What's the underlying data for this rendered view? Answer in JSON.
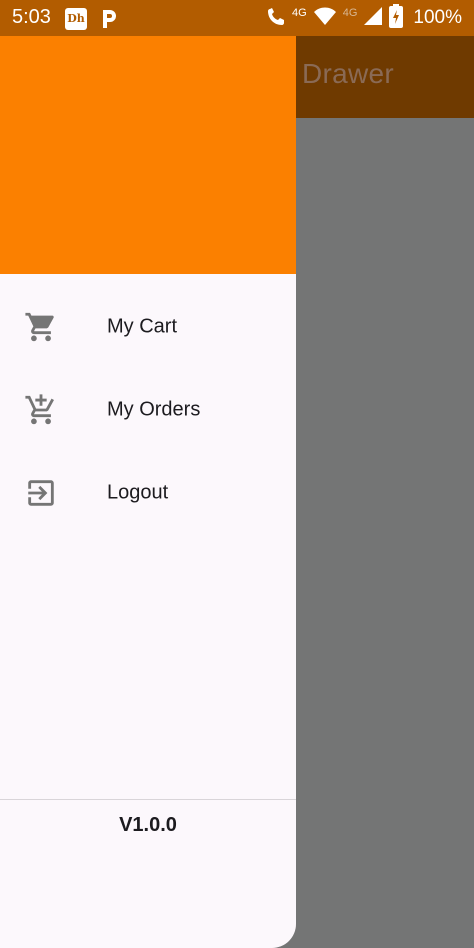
{
  "status_bar": {
    "time": "5:03",
    "app_icon_1": "Dh",
    "network_label_1": "4G",
    "network_label_2": "4G",
    "battery": "100%",
    "icons": [
      "disney-hotstar-icon",
      "parking-icon",
      "wifi-call-icon",
      "wifi-icon",
      "signal-icon",
      "battery-charging-icon"
    ]
  },
  "app_bar": {
    "title": "Drawer"
  },
  "drawer": {
    "header_color": "#fb8000",
    "items": [
      {
        "label": "My Cart",
        "icon": "shopping-cart-icon"
      },
      {
        "label": "My Orders",
        "icon": "add-shopping-cart-icon"
      },
      {
        "label": "Logout",
        "icon": "logout-icon"
      }
    ],
    "footer": {
      "version": "V1.0.0"
    }
  },
  "colors": {
    "status_bar": "#b25c00",
    "app_bar": "#6f3a00",
    "scrim": "#747575",
    "drawer_bg": "#fcf8fc",
    "icon": "#757575"
  }
}
